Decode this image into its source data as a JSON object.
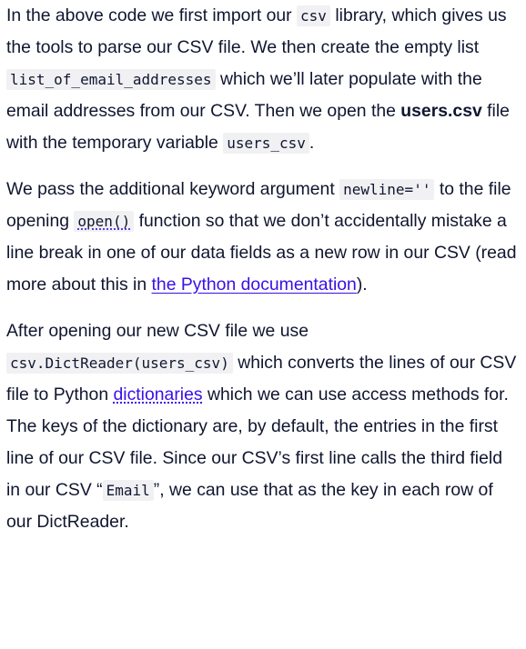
{
  "paragraphs": {
    "p1": {
      "t1": "In the above code we first import our ",
      "c1": "csv",
      "t2": " library, which gives us the tools to parse our CSV file. We then create the empty list ",
      "c2": "list_of_email_addresses",
      "t3": " which we’ll later populate with the email addresses from our CSV. Then we open the ",
      "b1": "users.csv",
      "t4": " file with the temporary variable ",
      "c3": "users_csv",
      "t5": "."
    },
    "p2": {
      "t1": "We pass the additional keyword argument ",
      "c1": "newline=''",
      "t2": " to the file opening ",
      "c2": "open()",
      "t3": " function so that we don’t accidentally mistake a line break in one of our data fields as a new row in our CSV (read more about this in ",
      "link1": "the Python documentation",
      "t4": ")."
    },
    "p3": {
      "t1": "After opening our new CSV file we use ",
      "c1": "csv.DictReader(users_csv)",
      "t2": " which converts the lines of our CSV file to Python ",
      "link1": "dictionaries",
      "t3": " which we can use access methods for. The keys of the dictionary are, by default, the entries in the first line of our CSV file. Since our CSV’s first line calls the third field in our CSV “",
      "c2": "Email",
      "t4": "”, we can use that as the key in each row of our DictReader."
    }
  }
}
